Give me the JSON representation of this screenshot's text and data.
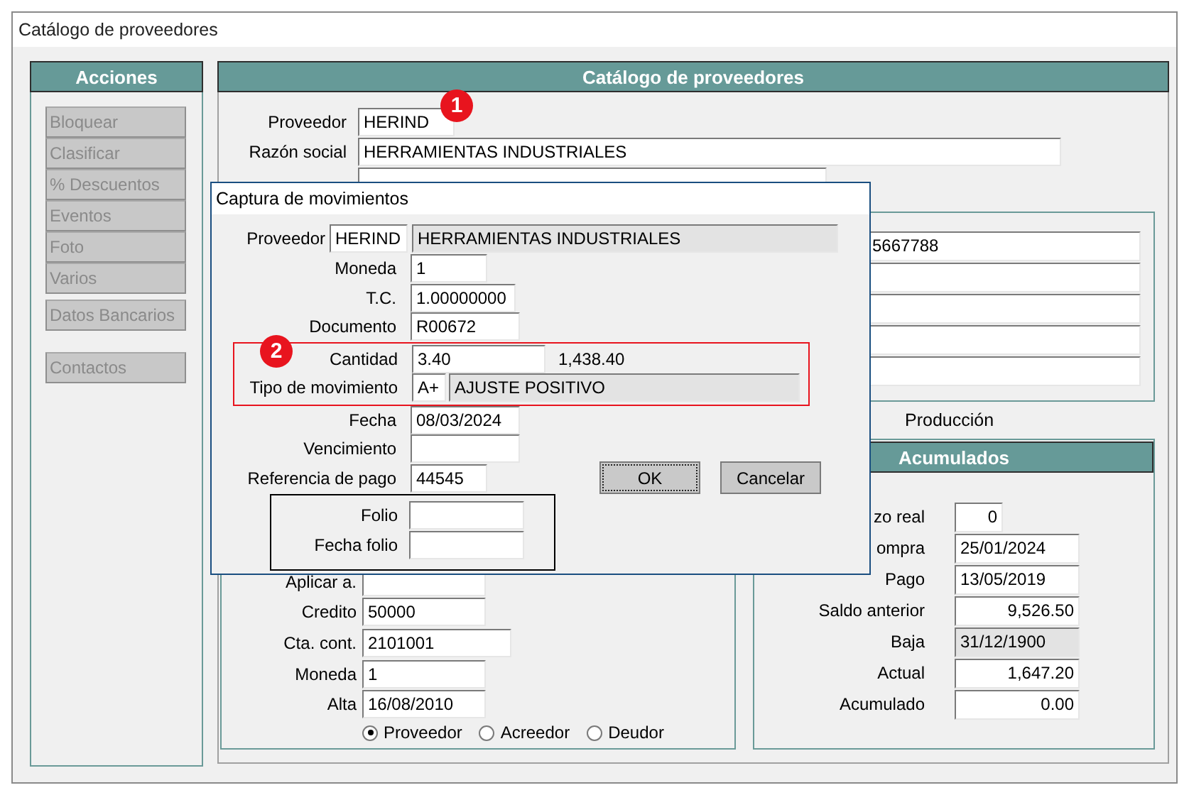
{
  "window": {
    "title": "Catálogo de proveedores"
  },
  "actions": {
    "title": "Acciones",
    "groups": [
      {
        "items": [
          {
            "label": "Bloquear",
            "disabled": true
          },
          {
            "label": "Clasificar",
            "disabled": true
          },
          {
            "label": "%  Descuentos",
            "disabled": true
          },
          {
            "label": "Eventos",
            "disabled": true
          },
          {
            "label": "Foto",
            "disabled": true
          },
          {
            "label": "Varios",
            "disabled": true
          }
        ]
      },
      {
        "items": [
          {
            "label": "Datos Bancarios",
            "disabled": true
          }
        ]
      },
      {
        "items": [
          {
            "label": "Contactos",
            "disabled": true
          }
        ]
      }
    ]
  },
  "catalog": {
    "title": "Catálogo de proveedores",
    "marker": "1",
    "header_fields": [
      {
        "label": "Proveedor",
        "value": "HERIND"
      },
      {
        "label": "Razón social",
        "value": "HERRAMIENTAS INDUSTRIALES"
      }
    ],
    "contact_fields": [
      {
        "value": "5667788"
      }
    ],
    "tab_label": "Producción",
    "general": {
      "fields": [
        {
          "label": "Aplicar a."
        },
        {
          "label": "Credito",
          "value": "50000"
        },
        {
          "label": "Cta. cont.",
          "value": "2101001"
        },
        {
          "label": "Moneda",
          "value": "1"
        },
        {
          "label": "Alta",
          "value": "16/08/2010"
        }
      ],
      "radios": [
        {
          "label": "Proveedor",
          "selected": true
        },
        {
          "label": "Acreedor",
          "selected": false
        },
        {
          "label": "Deudor",
          "selected": false
        }
      ]
    },
    "accumulated": {
      "title": "Acumulados",
      "fields": [
        {
          "label": "zo real",
          "value": "0",
          "kind": "amount"
        },
        {
          "label": "ompra",
          "value": "25/01/2024",
          "kind": "text"
        },
        {
          "label": "Pago",
          "value": "13/05/2019",
          "kind": "text"
        },
        {
          "label": "Saldo anterior",
          "value": "9,526.50",
          "kind": "amount"
        },
        {
          "label": "Baja",
          "value": "31/12/1900",
          "kind": "readonly"
        },
        {
          "label": "Actual",
          "value": "1,647.20",
          "kind": "amount"
        },
        {
          "label": "Acumulado",
          "value": "0.00",
          "kind": "amount"
        }
      ]
    }
  },
  "dialog": {
    "title": "Captura de movimientos",
    "supplier": {
      "label": "Proveedor",
      "code": "HERIND",
      "name": "HERRAMIENTAS INDUSTRIALES"
    },
    "fields_top": [
      {
        "label": "Moneda",
        "value": "1"
      },
      {
        "label": "T.C.",
        "value": "1.00000000"
      },
      {
        "label": "Documento",
        "value": "R00672"
      }
    ],
    "highlight": {
      "marker": "2",
      "quantity": {
        "label": "Cantidad",
        "value": "3.40",
        "total": "1,438.40"
      },
      "movement_type": {
        "label": "Tipo de movimiento",
        "code": "A+",
        "name": "AJUSTE POSITIVO"
      }
    },
    "fields_bottom": [
      {
        "label": "Fecha",
        "value": "08/03/2024"
      },
      {
        "label": "Vencimiento"
      },
      {
        "label": "Referencia de pago",
        "value": "44545"
      }
    ],
    "folio_fields": [
      {
        "label": "Folio"
      },
      {
        "label": "Fecha folio"
      }
    ],
    "buttons": [
      {
        "label": "OK",
        "focused": true
      },
      {
        "label": "Cancelar",
        "focused": false
      }
    ]
  }
}
